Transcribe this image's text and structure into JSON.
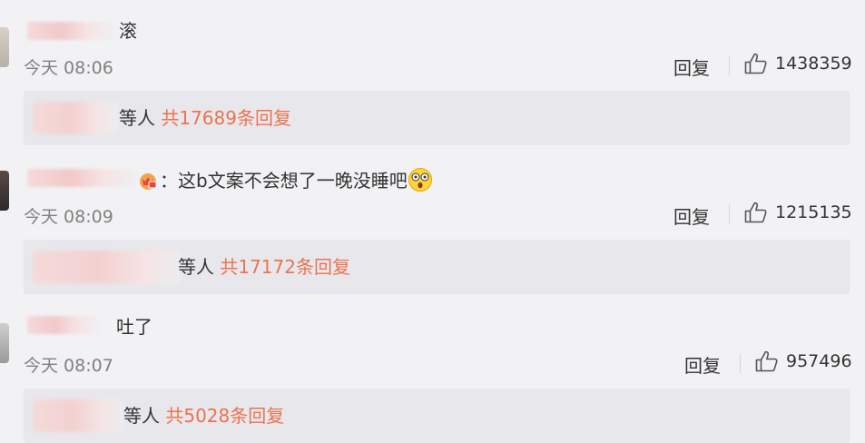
{
  "comments": [
    {
      "text": "滚",
      "time": "今天 08:06",
      "reply_label": "回复",
      "likes": "1438359",
      "replies_suffix": "等人",
      "replies_count": "共17689条回复"
    },
    {
      "text": "：这b文案不会想了一晚没睡吧",
      "time": "今天 08:09",
      "reply_label": "回复",
      "likes": "1215135",
      "replies_suffix": "等人",
      "replies_count": "共17172条回复"
    },
    {
      "text": "吐了",
      "time": "今天 08:07",
      "reply_label": "回复",
      "likes": "957496",
      "replies_suffix": "等人",
      "replies_count": "共5028条回复"
    }
  ],
  "icons": {
    "like": "thumbs-up-icon",
    "badge": "crown-badge-icon",
    "emoji": "shocked-face-emoji"
  },
  "colors": {
    "accent": "#eb7350",
    "background": "#f2f2f5",
    "reply_box": "#e8e8ec",
    "meta": "#808080"
  }
}
